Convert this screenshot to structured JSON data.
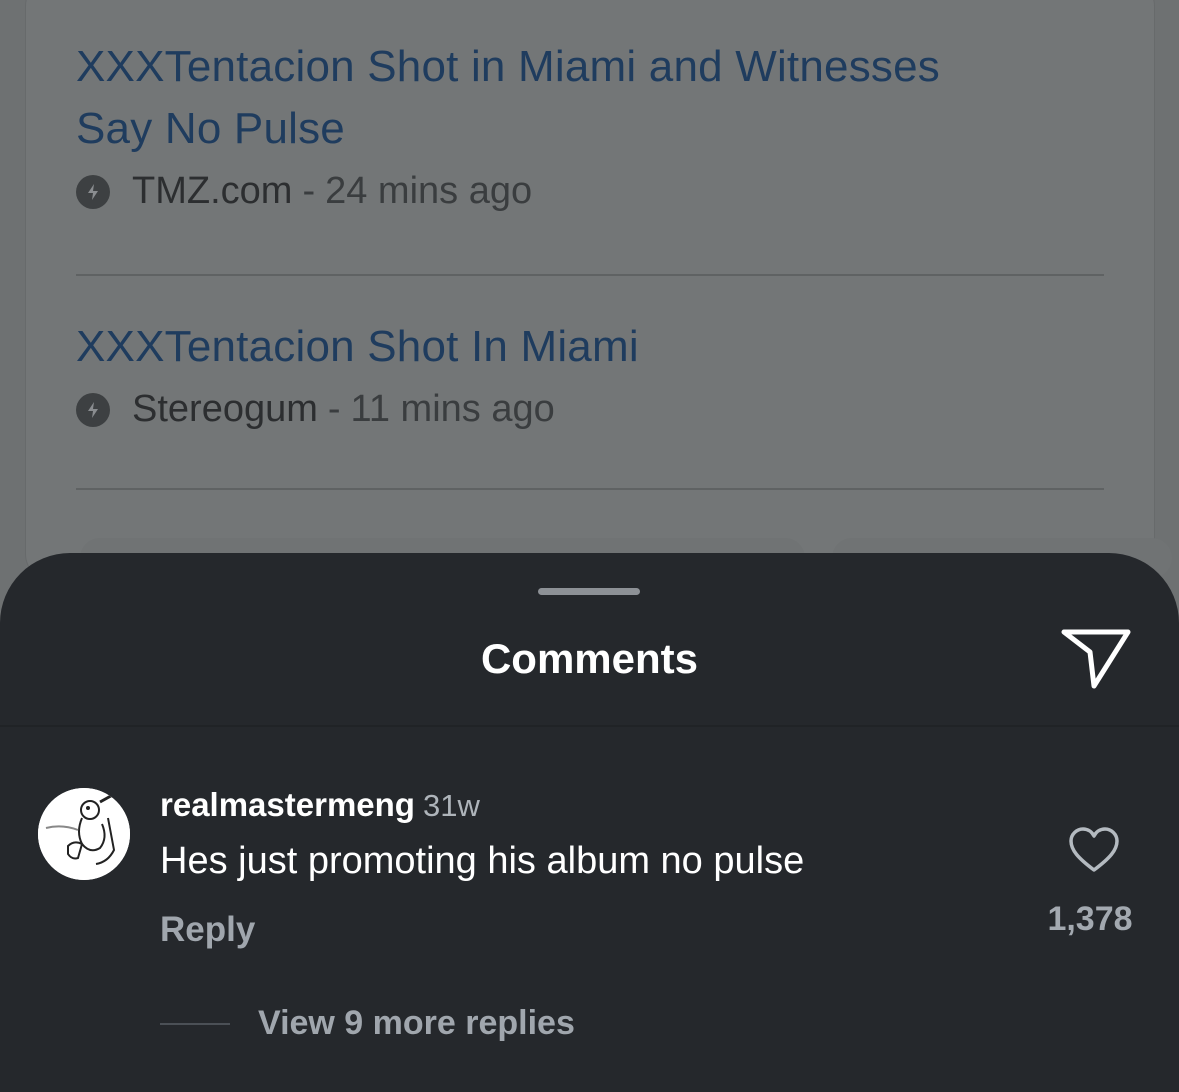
{
  "news": {
    "items": [
      {
        "title_line1": "XXXTentacion Shot in Miami and Witnesses",
        "title_line2": "Say No Pulse",
        "source": "TMZ.com",
        "separator": "-",
        "time": "24 mins ago"
      },
      {
        "title_line1": "XXXTentacion Shot In Miami",
        "source": "Stereogum",
        "separator": "-",
        "time": "11 mins ago"
      }
    ],
    "icon": "amp-lightning-icon"
  },
  "comments_sheet": {
    "title": "Comments",
    "share_icon": "send-icon",
    "comment": {
      "username": "realmastermeng",
      "time": "31w",
      "text": "Hes just promoting his album no pulse",
      "reply_label": "Reply",
      "like_icon": "heart-icon",
      "like_count": "1,378",
      "view_replies": "View 9 more replies"
    }
  },
  "colors": {
    "sheet_bg": "#25282c",
    "news_link": "#1f3c5e",
    "muted_text": "#a0a6ad"
  }
}
